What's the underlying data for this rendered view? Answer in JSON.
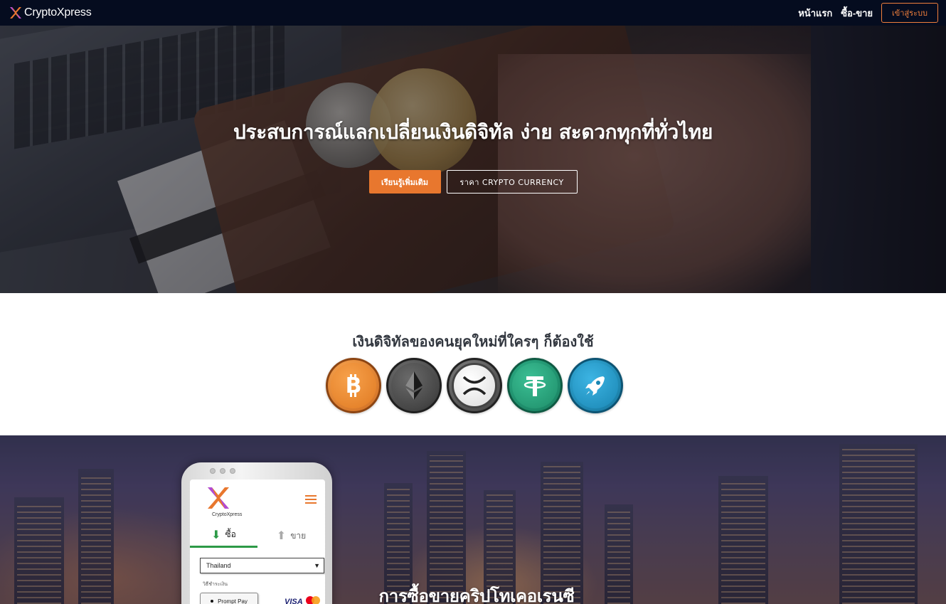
{
  "navbar": {
    "brand": "CryptoXpress",
    "links": [
      "หน้าแรก",
      "ซื้อ-ขาย"
    ],
    "login_label": "เข้าสู่ระบบ"
  },
  "hero": {
    "title": "ประสบการณ์แลกเปลี่ยนเงินดิจิทัล ง่าย สะดวกทุกที่ทั่วไทย",
    "primary_button": "เรียนรู้เพิ่มเติม",
    "secondary_button": "ราคา CRYPTO CURRENCY"
  },
  "coins": {
    "heading": "เงินดิจิทัลของคนยุคใหม่ที่ใครๆ ก็ต้องใช้",
    "items": [
      "bitcoin-icon",
      "ethereum-icon",
      "xrp-icon",
      "tether-icon",
      "rocket-coin-icon"
    ]
  },
  "promo": {
    "title": "การซื้อขายคริปโทเคอเรนซี"
  },
  "phone_app": {
    "logo_text": "CryptoXpress",
    "tab_buy": "ซื้อ",
    "tab_sell": "ขาย",
    "country_select": "Thailand",
    "payment_label": "วิธีชำระเงิน",
    "payment_option": "Prompt Pay",
    "card_brand": "VISA"
  },
  "colors": {
    "navbar_bg": "#050c1f",
    "accent_orange": "#e8772e",
    "login_border": "#f07f3c",
    "buy_tab_green": "#2d9a47"
  }
}
